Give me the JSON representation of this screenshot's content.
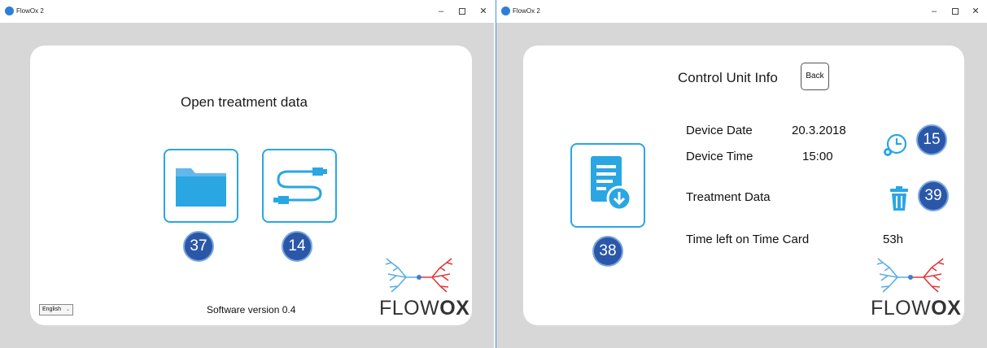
{
  "left_window": {
    "title": "FlowOx 2",
    "minimize": "–",
    "close": "✕",
    "heading": "Open treatment data",
    "folder_badge": "37",
    "usb_badge": "14",
    "language": "English",
    "version": "Software version 0.4",
    "logo_text_light": "FLOW",
    "logo_text_bold": "OX"
  },
  "right_window": {
    "title": "FlowOx 2",
    "minimize": "–",
    "close": "✕",
    "heading": "Control Unit Info",
    "back_label": "Back",
    "device_date_label": "Device Date",
    "device_date_value": "20.3.2018",
    "device_time_label": "Device Time",
    "device_time_value": "15:00",
    "treatment_data_label": "Treatment Data",
    "time_left_label": "Time left on Time Card",
    "time_left_value": "53h",
    "download_badge": "38",
    "clock_badge": "15",
    "trash_badge": "39",
    "logo_text_light": "FLOW",
    "logo_text_bold": "OX"
  },
  "colors": {
    "accent": "#2aa6e3",
    "badge": "#2a57a8",
    "background": "#d7d7d7",
    "logo_blue": "#5aaee0",
    "logo_red": "#e0393a"
  },
  "icons": [
    "app-icon",
    "folder-icon",
    "usb-cable-icon",
    "document-download-icon",
    "clock-gear-icon",
    "trash-icon",
    "chevron-down-icon"
  ]
}
